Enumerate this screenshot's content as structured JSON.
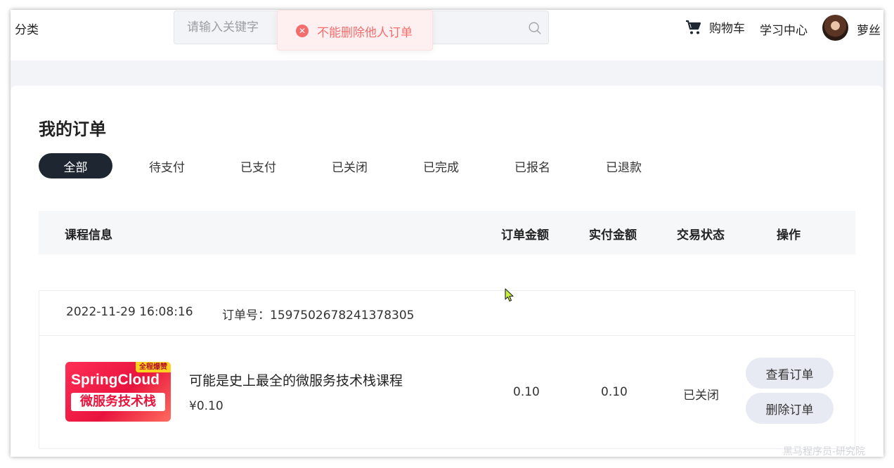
{
  "header": {
    "category_label": "分类",
    "search": {
      "placeholder": "请输入关键字",
      "value": ""
    },
    "toast": {
      "message": "不能删除他人订单",
      "icon": "error-circle-icon",
      "color": "#f56c6c"
    },
    "cart_label": "购物车",
    "study_center_label": "学习中心",
    "username": "萝丝"
  },
  "main": {
    "title": "我的订单",
    "tabs": [
      {
        "label": "全部",
        "active": true
      },
      {
        "label": "待支付",
        "active": false
      },
      {
        "label": "已支付",
        "active": false
      },
      {
        "label": "已关闭",
        "active": false
      },
      {
        "label": "已完成",
        "active": false
      },
      {
        "label": "已报名",
        "active": false
      },
      {
        "label": "已退款",
        "active": false
      }
    ],
    "columns": [
      "课程信息",
      "订单金额",
      "实付金额",
      "交易状态",
      "操作"
    ],
    "orders": [
      {
        "time": "2022-11-29 16:08:16",
        "order_no": "订单号：1597502678241378305",
        "thumbnail": {
          "badge": "全程爆赞",
          "line1": "SpringCloud",
          "line2": "微服务技术栈"
        },
        "course_title": "可能是史上最全的微服务技术栈课程",
        "course_price": "¥0.10",
        "order_amount": "0.10",
        "paid_amount": "0.10",
        "status": "已关闭",
        "actions": {
          "view": "查看订单",
          "delete": "删除订单"
        }
      }
    ]
  },
  "watermark": "黑马程序员-研究院",
  "colors": {
    "active_tab": "#1e2632",
    "page_bg": "#f3f4f7",
    "error": "#f56c6c",
    "button_bg": "#e8eaf3"
  }
}
